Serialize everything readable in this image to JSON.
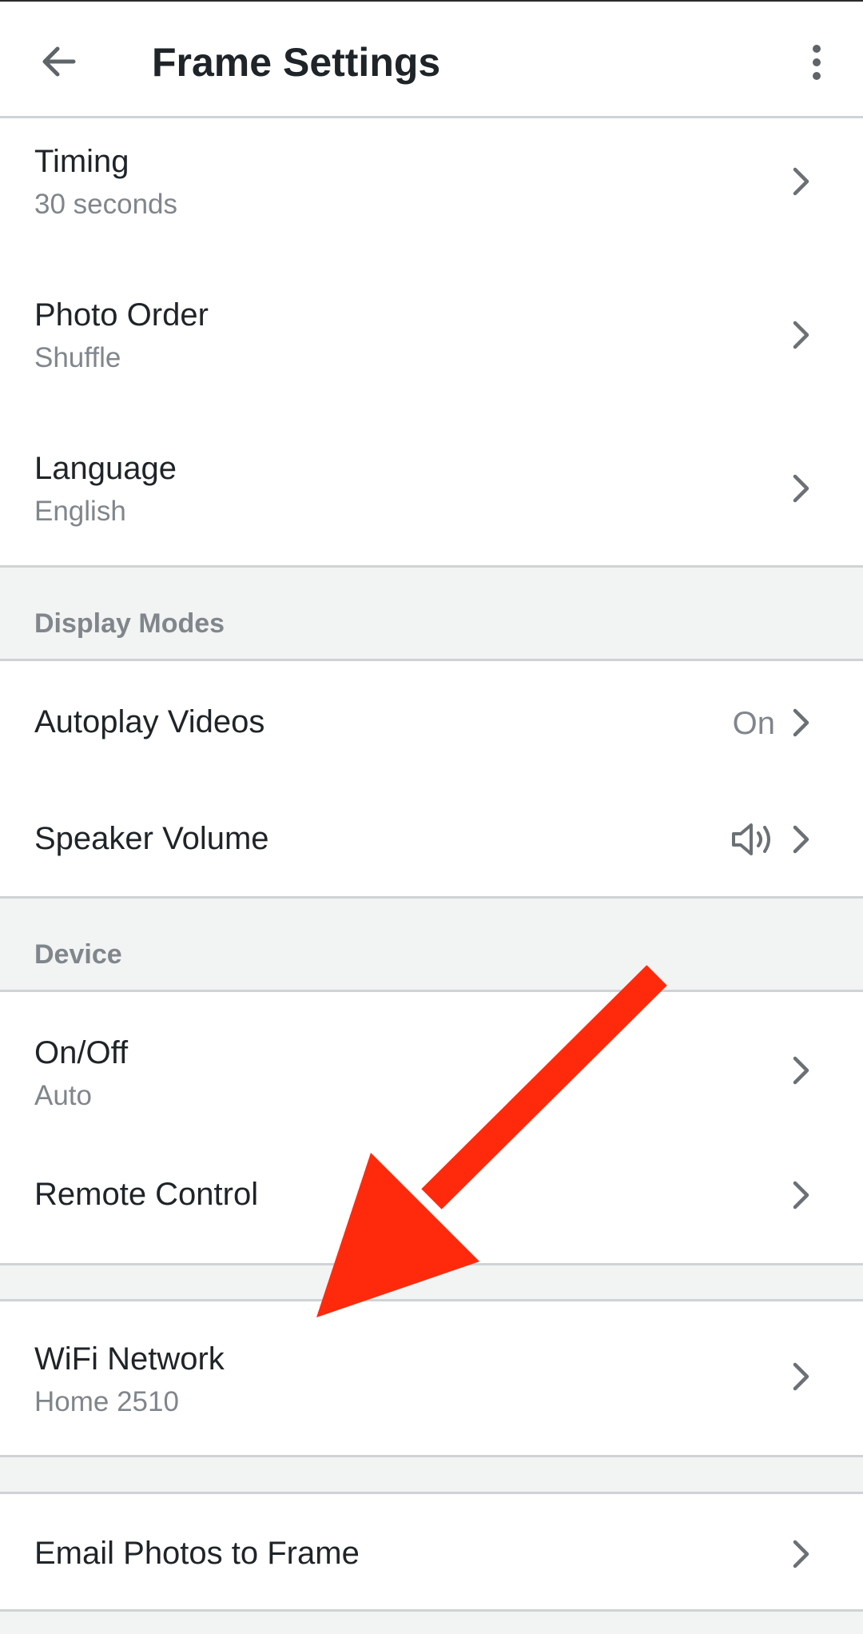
{
  "app_bar": {
    "title": "Frame Settings",
    "back_icon": "arrow-left-icon",
    "overflow_icon": "more-vertical-icon"
  },
  "general": {
    "items": [
      {
        "title": "Timing",
        "subtitle": "30 seconds"
      },
      {
        "title": "Photo Order",
        "subtitle": "Shuffle"
      },
      {
        "title": "Language",
        "subtitle": "English"
      }
    ]
  },
  "display_modes": {
    "header": "Display Modes",
    "autoplay": {
      "title": "Autoplay Videos",
      "value": "On"
    },
    "volume": {
      "title": "Speaker Volume",
      "icon": "speaker-volume-icon"
    }
  },
  "device": {
    "header": "Device",
    "onoff": {
      "title": "On/Off",
      "subtitle": "Auto"
    },
    "remote": {
      "title": "Remote Control"
    }
  },
  "wifi": {
    "title": "WiFi Network",
    "subtitle": "Home 2510"
  },
  "email": {
    "title": "Email Photos to Frame"
  },
  "colors": {
    "annotation_arrow": "#ff2a0c",
    "divider": "#cfd3d5",
    "section_bg": "#f2f3f3",
    "secondary_text": "#80868b"
  }
}
